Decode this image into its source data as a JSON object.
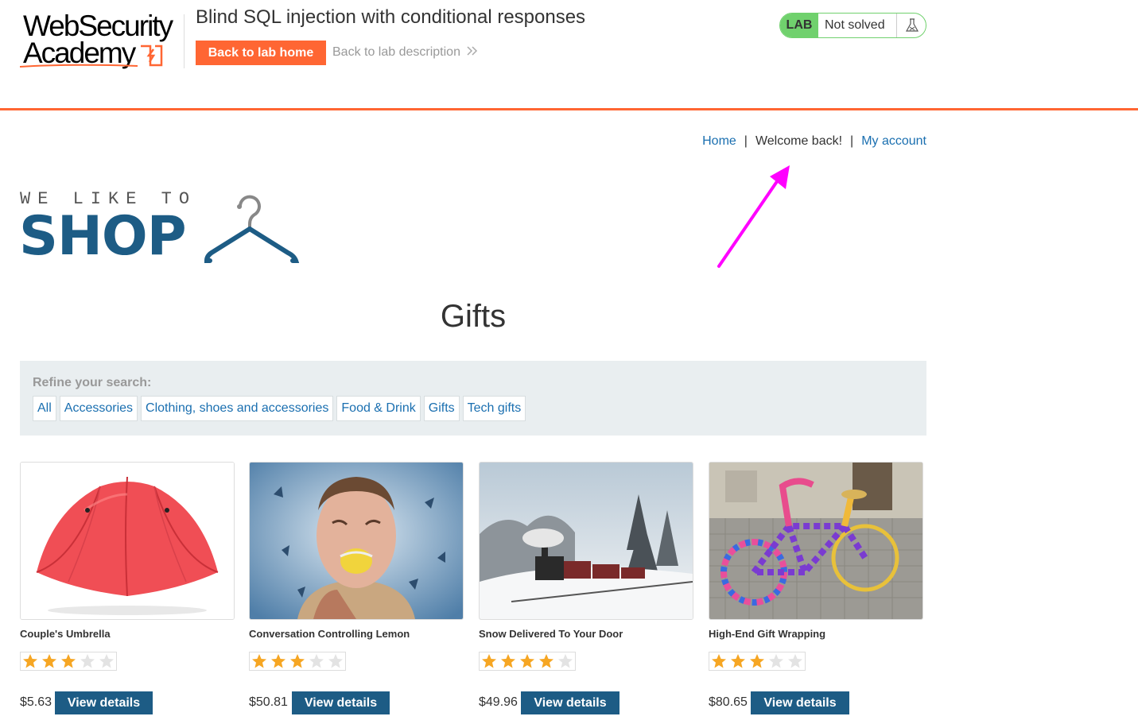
{
  "academy": {
    "logo_line1": "WebSecurity",
    "logo_line2": "Academy",
    "lab_title": "Blind SQL injection with conditional responses",
    "back_home_label": "Back to lab home",
    "back_desc_label": "Back to lab description",
    "lab_badge": "LAB",
    "lab_status": "Not solved",
    "accent_color": "#ff6633",
    "status_color": "#70d16d",
    "status_icon": "flask-icon"
  },
  "nav": {
    "home": "Home",
    "sep1": "|",
    "welcome": "Welcome back!",
    "sep2": "|",
    "account": "My account"
  },
  "shop_logo": {
    "tagline": "WE LIKE TO",
    "word": "SHOP",
    "icon": "hanger-icon",
    "brand_color": "#1d5c85"
  },
  "heading": "Gifts",
  "filters": {
    "label": "Refine your search:",
    "items": [
      "All",
      "Accessories",
      "Clothing, shoes and accessories",
      "Food & Drink",
      "Gifts",
      "Tech gifts"
    ]
  },
  "products": [
    {
      "name": "Couple's Umbrella",
      "rating": 3,
      "price": "$5.63",
      "button": "View details",
      "image": "red-umbrella-image"
    },
    {
      "name": "Conversation Controlling Lemon",
      "rating": 3,
      "price": "$50.81",
      "button": "View details",
      "image": "man-biting-lemon-image"
    },
    {
      "name": "Snow Delivered To Your Door",
      "rating": 4,
      "price": "$49.96",
      "button": "View details",
      "image": "snowy-train-image"
    },
    {
      "name": "High-End Gift Wrapping",
      "rating": 3,
      "price": "$80.65",
      "button": "View details",
      "image": "yarn-bombed-bicycle-image"
    }
  ]
}
